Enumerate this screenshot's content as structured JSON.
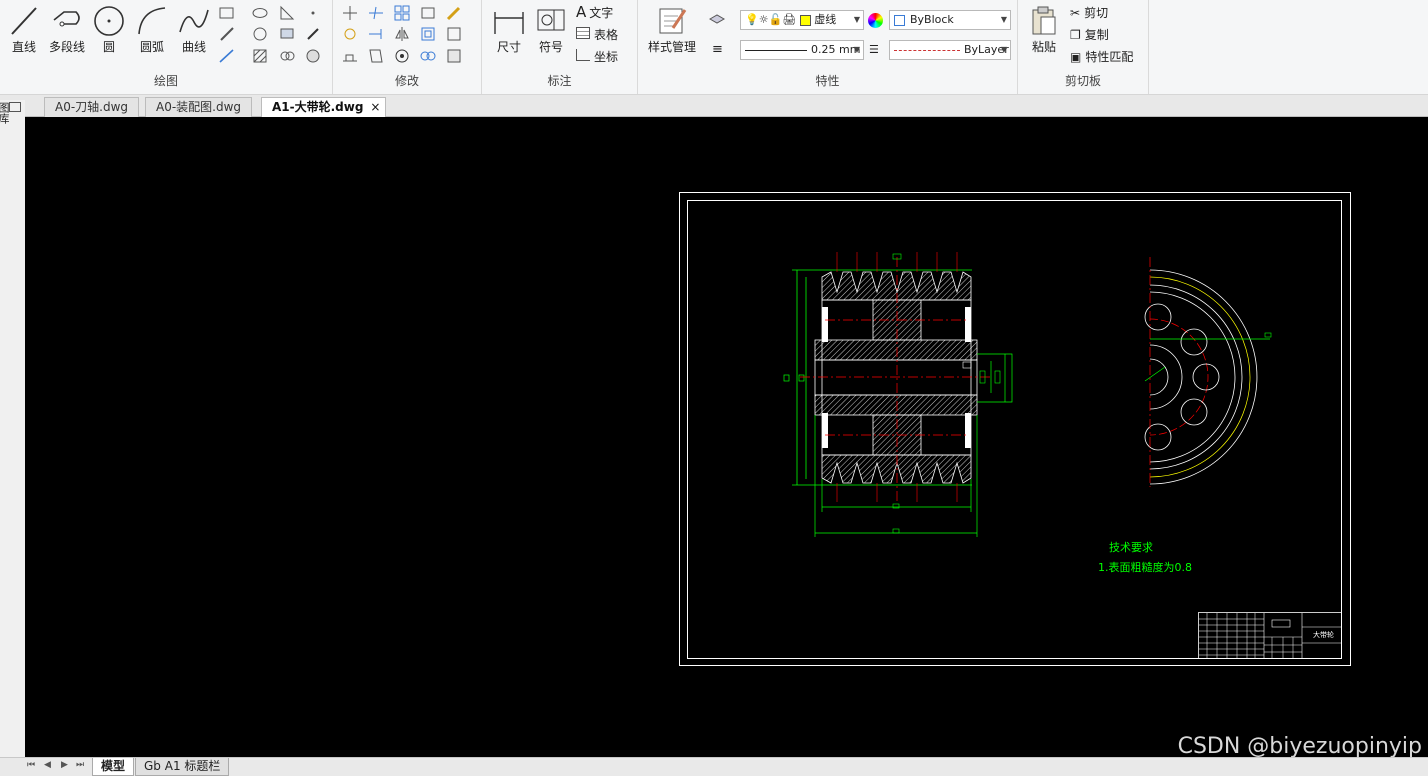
{
  "ribbon": {
    "draw": {
      "title": "绘图",
      "line": "直线",
      "polyline": "多段线",
      "circle": "圆",
      "arc": "圆弧",
      "curve": "曲线"
    },
    "modify": {
      "title": "修改"
    },
    "annotate": {
      "title": "标注",
      "dimension": "尺寸",
      "symbol": "符号",
      "text": "文字",
      "table": "表格",
      "coordinate": "坐标"
    },
    "properties": {
      "title": "特性",
      "style_manager": "样式管理",
      "layer_name": "虚线",
      "color": "ByBlock",
      "lineweight": "0.25 mm",
      "linetype": "ByLayer"
    },
    "clipboard": {
      "title": "剪切板",
      "paste": "粘贴",
      "cut": "剪切",
      "copy": "复制",
      "match": "特性匹配"
    }
  },
  "tabs": [
    {
      "label": "A0-刀轴.dwg",
      "active": false
    },
    {
      "label": "A0-装配图.dwg",
      "active": false
    },
    {
      "label": "A1-大带轮.dwg",
      "active": true
    }
  ],
  "close_glyph": "×",
  "left_panel_label": "图库",
  "drawing": {
    "tech_title": "技术要求",
    "tech_note": "1.表面粗糙度为0.8",
    "title_block_name": "大带轮"
  },
  "bottom_tabs": [
    {
      "label": "模型",
      "active": true
    },
    {
      "label": "Gb A1 标题栏",
      "active": false
    }
  ],
  "nav_glyphs": [
    "⏮",
    "◀",
    "▶",
    "⏭"
  ],
  "watermark": "CSDN @biyezuopinyip",
  "colors": {
    "canvas": "#000000",
    "green": "#00ff00",
    "red": "#ff0000",
    "white": "#ffffff",
    "ribbon_bg": "#f5f6f7"
  }
}
